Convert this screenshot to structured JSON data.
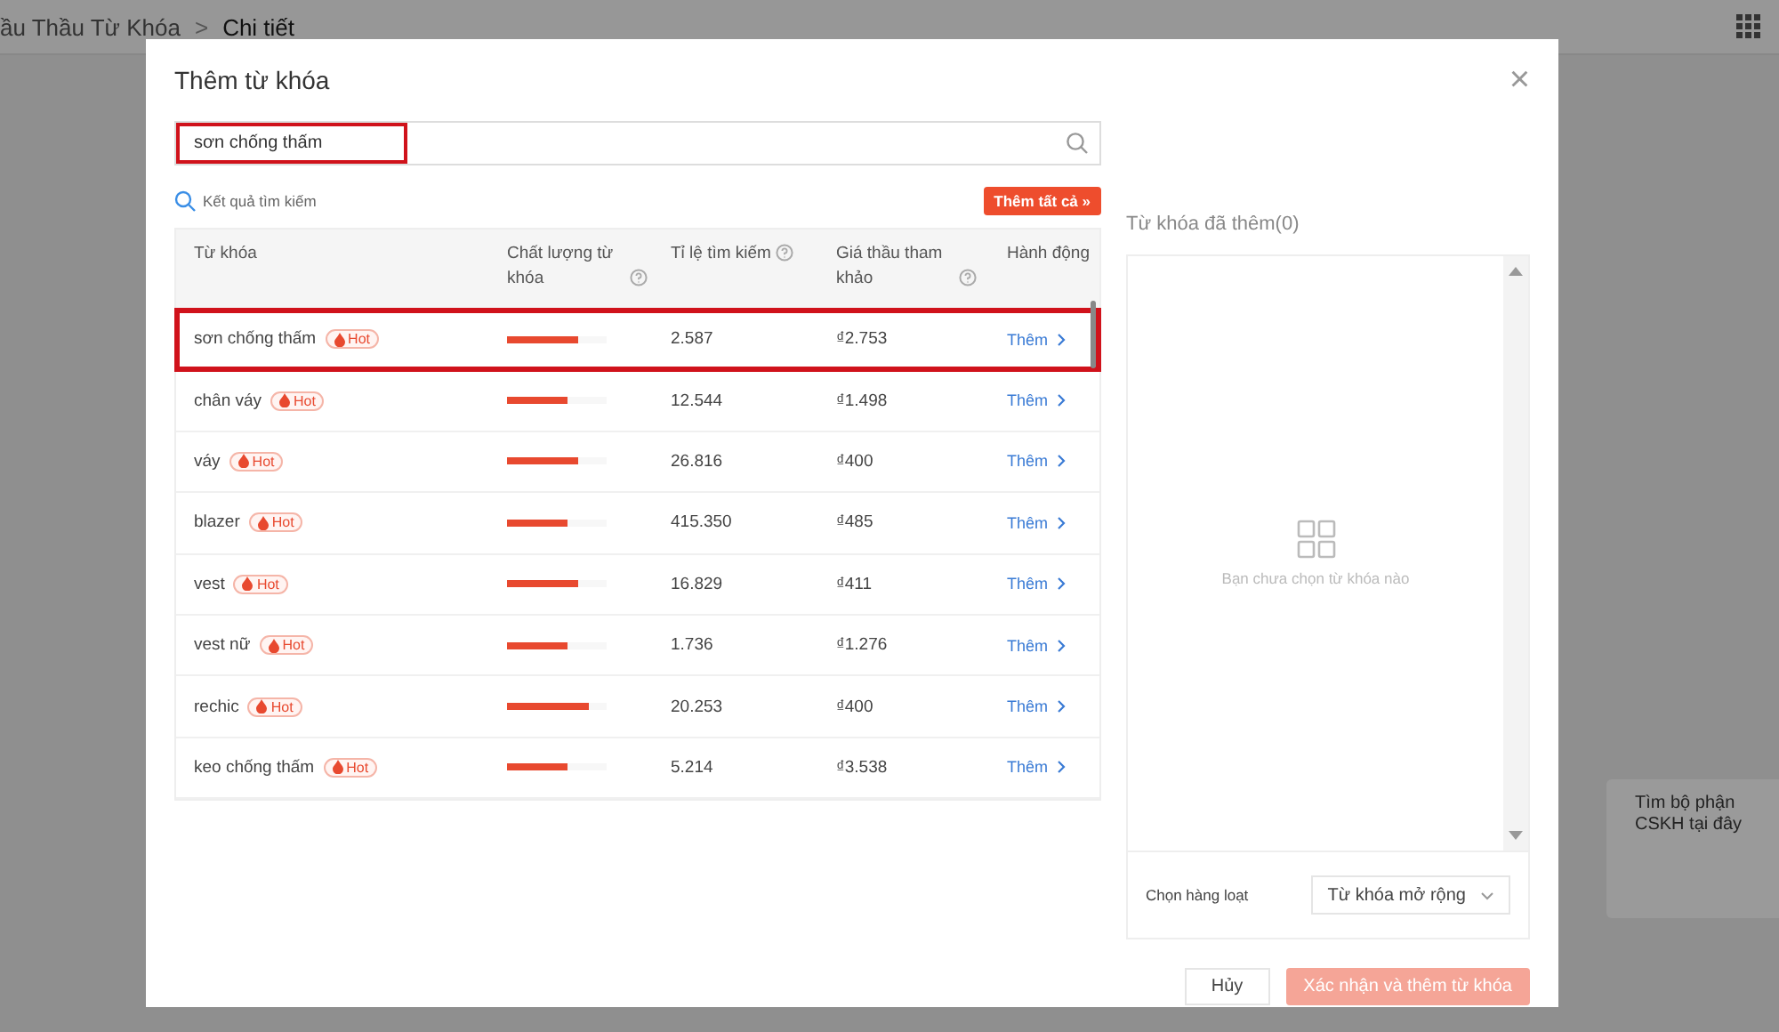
{
  "breadcrumb": {
    "items": [
      "ầu Thầu Từ Khóa",
      "Chi tiết"
    ],
    "separator": ">"
  },
  "toast": {
    "text": "Tìm bộ phận CSKH tại đây"
  },
  "dialog": {
    "title": "Thêm từ khóa",
    "close": "×",
    "search": {
      "value": "sơn chống thấm",
      "highlighted": true
    },
    "results_label": "Kết quả tìm kiếm",
    "add_all_button": "Thêm tất cả »",
    "table": {
      "columns": [
        {
          "label": "Từ khóa",
          "help": false
        },
        {
          "label": "Chất lượng từ khóa",
          "help": true
        },
        {
          "label": "Tỉ lệ tìm kiếm",
          "help": true
        },
        {
          "label": "Giá thầu tham khảo",
          "help": true
        },
        {
          "label": "Hành động",
          "help": false
        }
      ],
      "rows": [
        {
          "keyword": "sơn chống thấm",
          "badge": "Hot",
          "level": 0.71,
          "search_rate": "2.587",
          "bid": "₫2.753",
          "action": "Thêm",
          "highlighted": true
        },
        {
          "keyword": "chân váy",
          "badge": "Hot",
          "level": 0.6,
          "search_rate": "12.544",
          "bid": "₫1.498",
          "action": "Thêm",
          "highlighted": false
        },
        {
          "keyword": "váy",
          "badge": "Hot",
          "level": 0.71,
          "search_rate": "26.816",
          "bid": "₫400",
          "action": "Thêm",
          "highlighted": false
        },
        {
          "keyword": "blazer",
          "badge": "Hot",
          "level": 0.6,
          "search_rate": "415.350",
          "bid": "₫485",
          "action": "Thêm",
          "highlighted": false
        },
        {
          "keyword": "vest",
          "badge": "Hot",
          "level": 0.71,
          "search_rate": "16.829",
          "bid": "₫411",
          "action": "Thêm",
          "highlighted": false
        },
        {
          "keyword": "vest nữ",
          "badge": "Hot",
          "level": 0.6,
          "search_rate": "1.736",
          "bid": "₫1.276",
          "action": "Thêm",
          "highlighted": false
        },
        {
          "keyword": "rechic",
          "badge": "Hot",
          "level": 0.82,
          "search_rate": "20.253",
          "bid": "₫400",
          "action": "Thêm",
          "highlighted": false
        },
        {
          "keyword": "keo chống thấm",
          "badge": "Hot",
          "level": 0.6,
          "search_rate": "5.214",
          "bid": "₫3.538",
          "action": "Thêm",
          "highlighted": false
        }
      ]
    },
    "added_title": "Từ khóa đã thêm(0)",
    "empty_text": "Bạn chưa chọn từ khóa nào",
    "bulk_label": "Chọn hàng loạt",
    "bulk_select": "Từ khóa mở rộng",
    "cancel_button": "Hủy",
    "confirm_button": {
      "label": "Xác nhận và thêm từ khóa",
      "disabled": true
    }
  }
}
